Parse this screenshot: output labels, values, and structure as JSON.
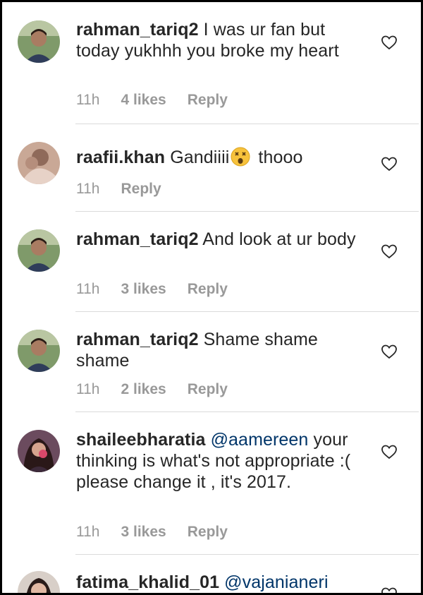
{
  "comments": [
    {
      "username": "rahman_tariq2",
      "text": " I was ur fan but today yukhhh you broke my heart",
      "time": "11h",
      "likes": "4 likes",
      "reply": "Reply"
    },
    {
      "username": "raafii.khan",
      "text_before": " Gandiiii",
      "text_after": " thooo",
      "emoji": "dizzy-face-emoji",
      "time": "11h",
      "reply": "Reply"
    },
    {
      "username": "rahman_tariq2",
      "text": " And look at ur body",
      "time": "11h",
      "likes": "3 likes",
      "reply": "Reply"
    },
    {
      "username": "rahman_tariq2",
      "text": " Shame shame shame",
      "time": "11h",
      "likes": "2 likes",
      "reply": "Reply"
    },
    {
      "username": "shaileebharatia",
      "mention": "@aamereen",
      "text": " your thinking is what's not appropriate :( please change it , it's 2017.",
      "time": "11h",
      "likes": "3 likes",
      "reply": "Reply"
    },
    {
      "username": "fatima_khalid_01",
      "mention": "@vajanianeri"
    }
  ],
  "icons": {
    "like": "heart-outline-icon"
  },
  "colors": {
    "text": "#262626",
    "meta": "#999999",
    "mention": "#003569",
    "divider": "#dbdbdb"
  }
}
